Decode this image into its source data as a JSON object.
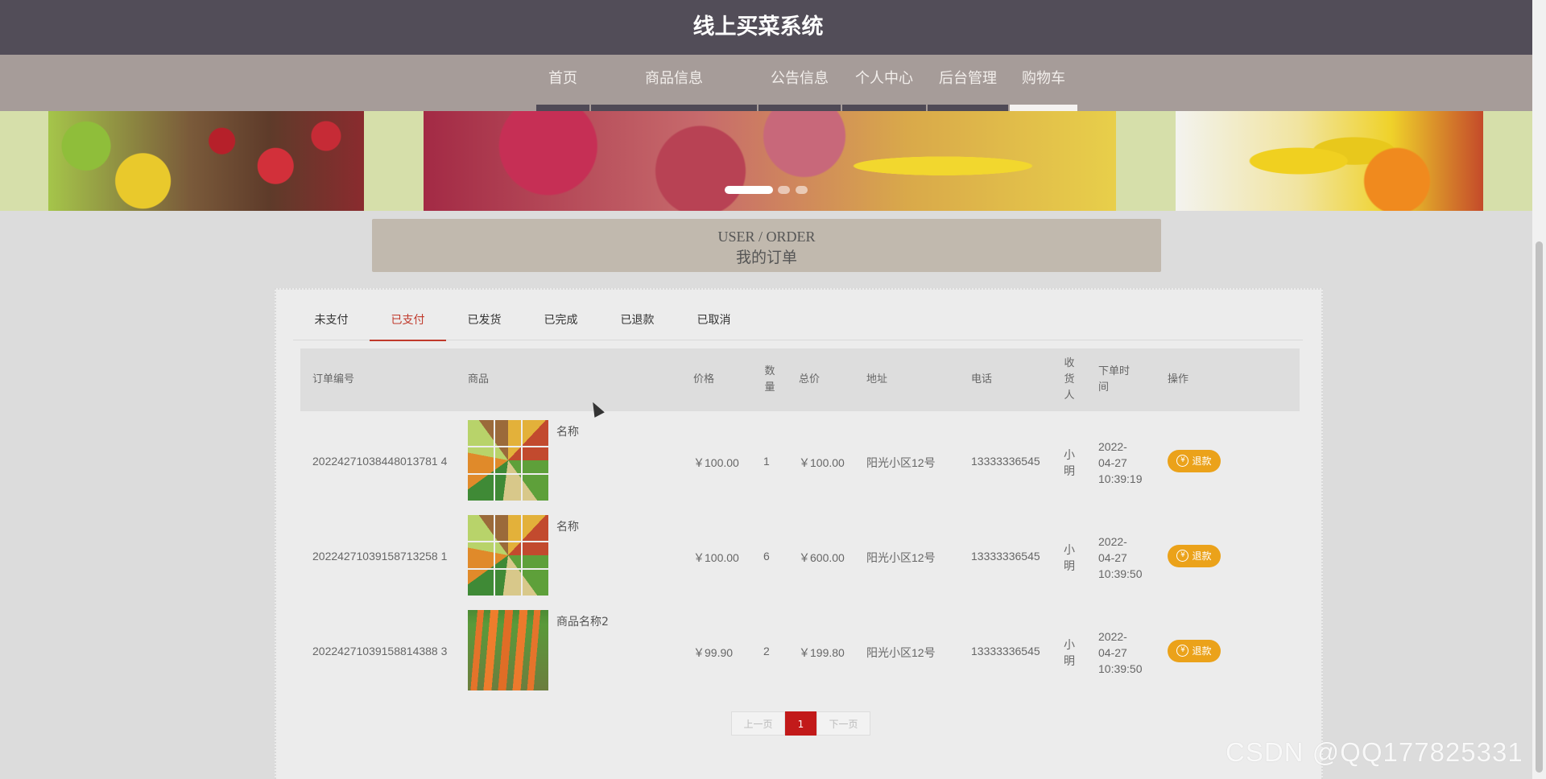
{
  "header": {
    "title": "线上买菜系统"
  },
  "nav": {
    "items": [
      {
        "label": "首页"
      },
      {
        "label": "商品信息"
      },
      {
        "label": "公告信息"
      },
      {
        "label": "个人中心"
      },
      {
        "label": "后台管理"
      },
      {
        "label": "购物车"
      }
    ],
    "active_index": 5
  },
  "banner": {
    "slide_count": 3,
    "active_slide": 0
  },
  "section": {
    "title_en": "USER / ORDER",
    "title_cn": "我的订单"
  },
  "tabs": {
    "items": [
      "未支付",
      "已支付",
      "已发货",
      "已完成",
      "已退款",
      "已取消"
    ],
    "active_index": 1
  },
  "table": {
    "columns": {
      "order_no": "订单编号",
      "goods": "商品",
      "price": "价格",
      "qty": [
        "数",
        "量"
      ],
      "total": "总价",
      "address": "地址",
      "phone": "电话",
      "receiver": [
        "收",
        "货",
        "人"
      ],
      "order_time": [
        "下单时",
        "间"
      ],
      "action": "操作"
    },
    "rows": [
      {
        "order_no": "20224271038448013781 4",
        "goods_name": "名称",
        "image": "mixed-vegetables-image",
        "price": "￥100.00",
        "qty": "1",
        "total": "￥100.00",
        "address": "阳光小区12号",
        "phone": "13333336545",
        "receiver": [
          "小",
          "明"
        ],
        "time": [
          "2022-",
          "04-27",
          "10:39:19"
        ],
        "action": "退款"
      },
      {
        "order_no": "20224271039158713258 1",
        "goods_name": "名称",
        "image": "mixed-vegetables-image",
        "price": "￥100.00",
        "qty": "6",
        "total": "￥600.00",
        "address": "阳光小区12号",
        "phone": "13333336545",
        "receiver": [
          "小",
          "明"
        ],
        "time": [
          "2022-",
          "04-27",
          "10:39:50"
        ],
        "action": "退款"
      },
      {
        "order_no": "20224271039158814388 3",
        "goods_name": "商品名称2",
        "image": "carrots-image",
        "price": "￥99.90",
        "qty": "2",
        "total": "￥199.80",
        "address": "阳光小区12号",
        "phone": "13333336545",
        "receiver": [
          "小",
          "明"
        ],
        "time": [
          "2022-",
          "04-27",
          "10:39:50"
        ],
        "action": "退款"
      }
    ]
  },
  "pagination": {
    "prev": "上一页",
    "current": "1",
    "next": "下一页"
  },
  "watermark": "CSDN @QQ177825331",
  "colors": {
    "header_bg": "#524d58",
    "nav_bg": "#a69c99",
    "accent_red": "#c0392b",
    "refund_orange": "#eba21a"
  }
}
